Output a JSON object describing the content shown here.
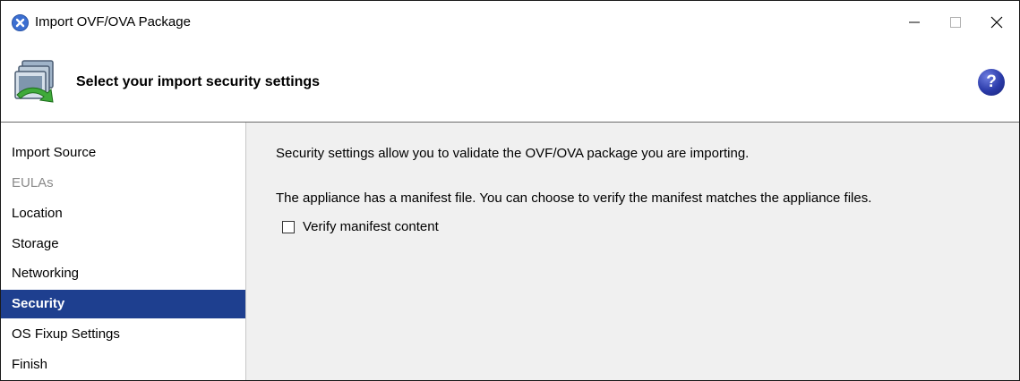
{
  "window": {
    "title": "Import OVF/OVA Package",
    "icon": "xencenter-app-icon"
  },
  "header": {
    "title": "Select your import security settings",
    "icon": "import-package-icon",
    "help_label": "?"
  },
  "sidebar": {
    "items": [
      {
        "label": "Import Source",
        "state": "normal"
      },
      {
        "label": "EULAs",
        "state": "disabled"
      },
      {
        "label": "Location",
        "state": "normal"
      },
      {
        "label": "Storage",
        "state": "normal"
      },
      {
        "label": "Networking",
        "state": "normal"
      },
      {
        "label": "Security",
        "state": "selected"
      },
      {
        "label": "OS Fixup Settings",
        "state": "normal"
      },
      {
        "label": "Finish",
        "state": "normal"
      }
    ]
  },
  "content": {
    "description": "Security settings allow you to validate the OVF/OVA package you are importing.",
    "manifest_text": "The appliance has a manifest file. You can choose to verify the manifest matches the appliance files.",
    "verify_manifest": {
      "label": "Verify manifest content",
      "checked": false
    }
  },
  "colors": {
    "selected_bg": "#1e3f8f",
    "content_bg": "#f0f0f0",
    "disabled_text": "#8a8a8a"
  }
}
